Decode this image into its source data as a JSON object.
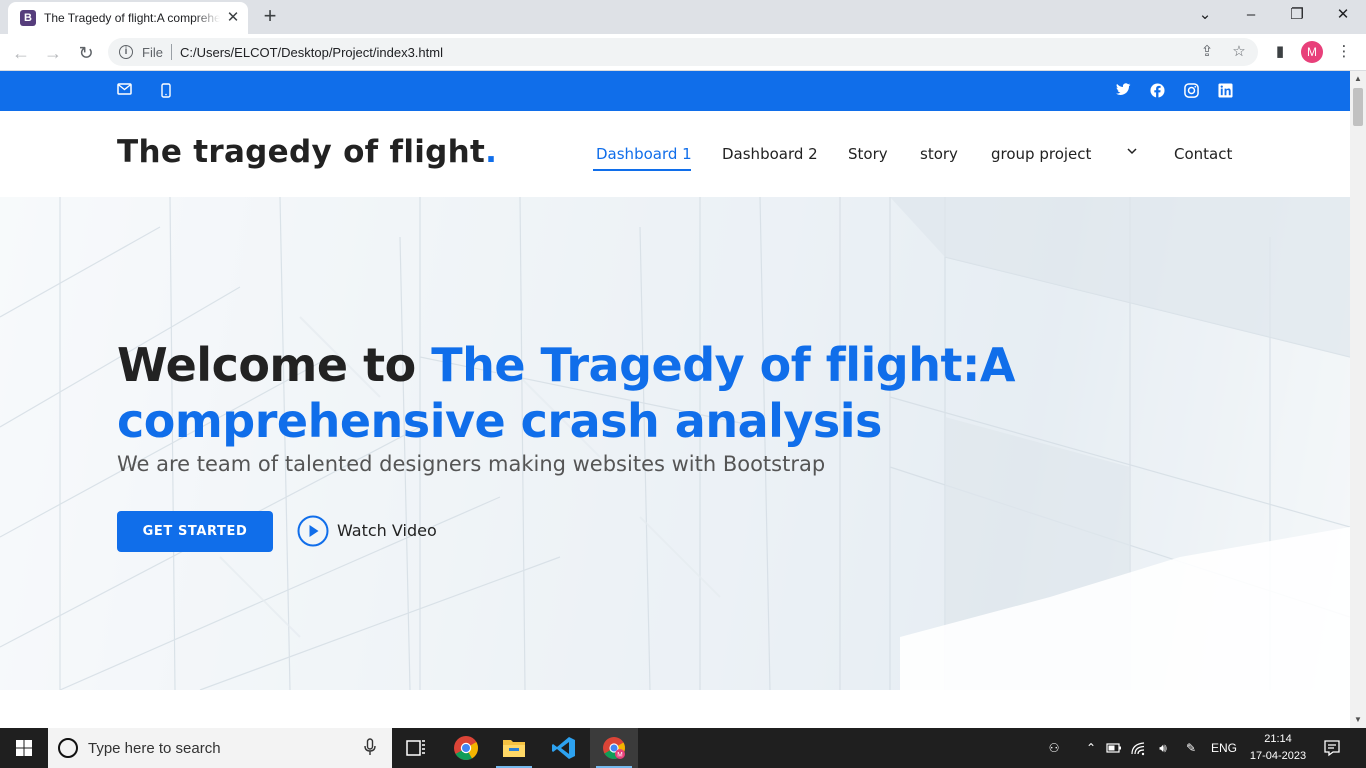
{
  "browser": {
    "tab_title": "The Tragedy of flight:A comprehensive crash analysis",
    "tab_favicon": "B",
    "file_label": "File",
    "url": "C:/Users/ELCOT/Desktop/Project/index3.html",
    "profile_initial": "M"
  },
  "topbar": {
    "color": "#106eea",
    "left_icons": [
      "envelope-icon",
      "phone-icon"
    ],
    "social_icons": [
      "twitter-icon",
      "facebook-icon",
      "instagram-icon",
      "linkedin-icon"
    ]
  },
  "header": {
    "logo_text": "The tragedy of flight",
    "logo_dot": ".",
    "nav": [
      {
        "label": "Dashboard 1",
        "active": true
      },
      {
        "label": "Dashboard 2"
      },
      {
        "label": "Story"
      },
      {
        "label": "story"
      },
      {
        "label": "group project",
        "dropdown": true
      },
      {
        "label": "Contact"
      }
    ]
  },
  "hero": {
    "title_prefix": "Welcome to ",
    "title_accent": "The Tragedy of flight:A comprehensive crash analysis",
    "subtitle": "We are team of talented designers making websites with Bootstrap",
    "cta_label": "GET STARTED",
    "watch_label": "Watch Video"
  },
  "taskbar": {
    "search_placeholder": "Type here to search",
    "language": "ENG",
    "time": "21:14",
    "date": "17-04-2023"
  },
  "colors": {
    "accent": "#106eea",
    "text_dark": "#222222"
  }
}
